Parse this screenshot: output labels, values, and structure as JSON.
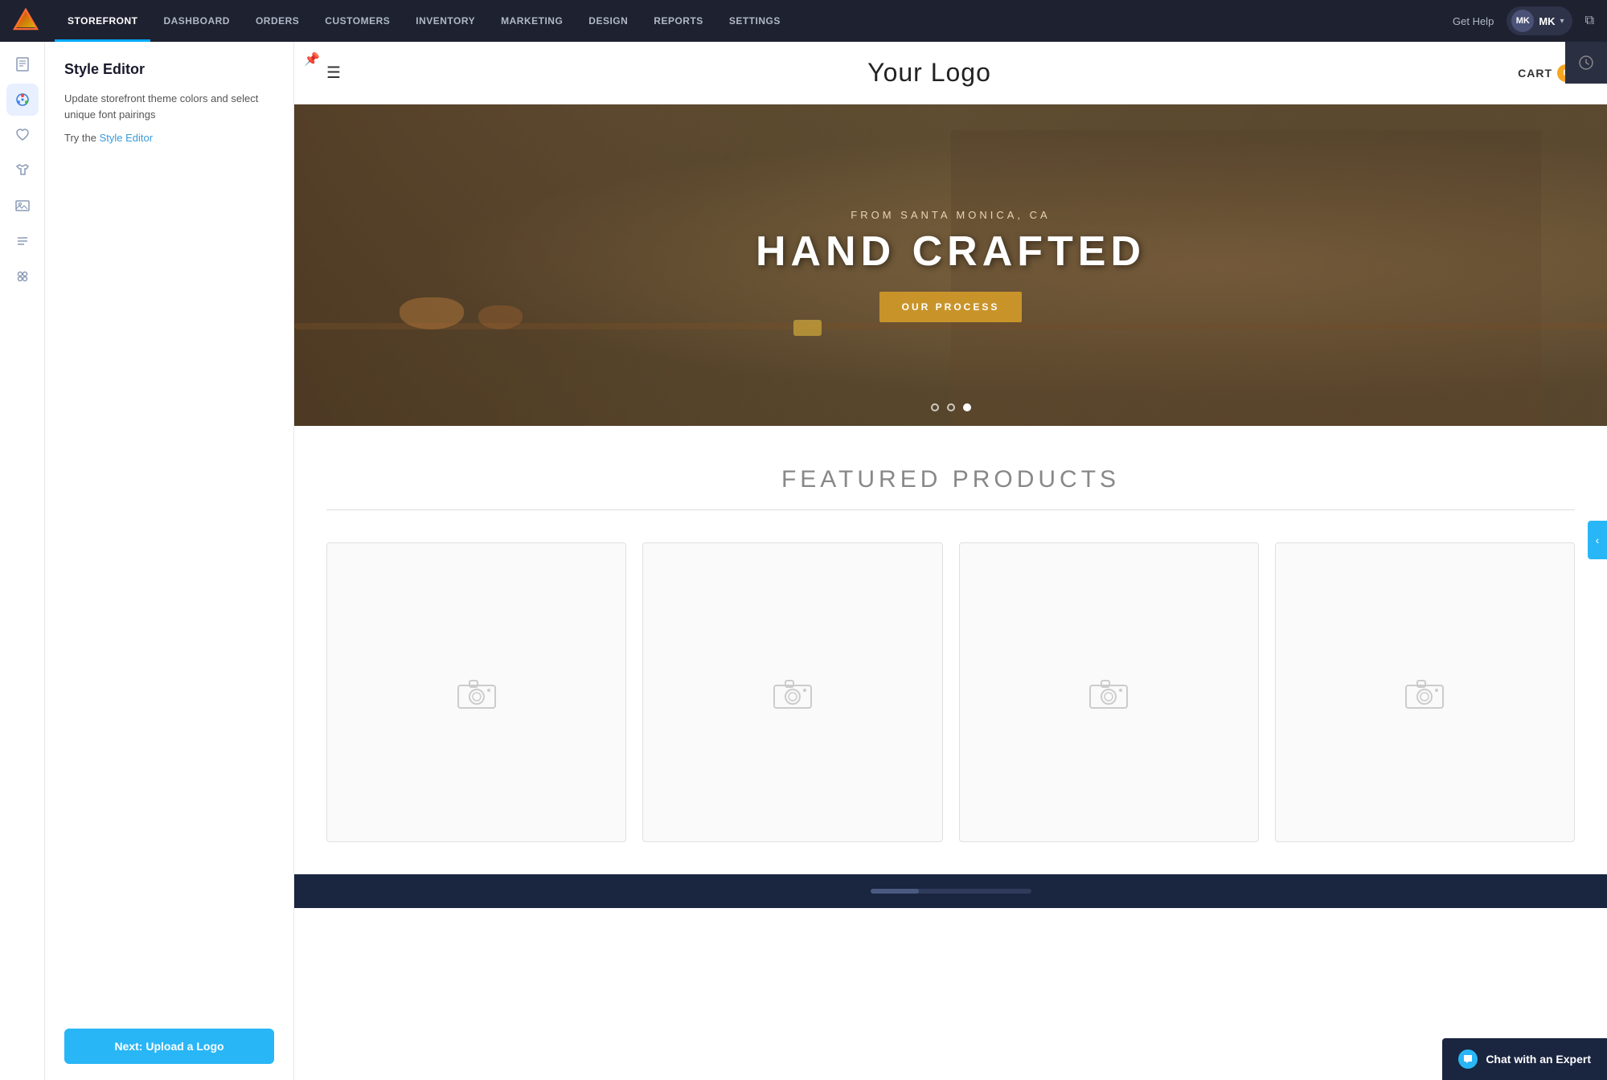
{
  "topNav": {
    "items": [
      {
        "label": "STOREFRONT",
        "active": true
      },
      {
        "label": "DASHBOARD",
        "active": false
      },
      {
        "label": "ORDERS",
        "active": false
      },
      {
        "label": "CUSTOMERS",
        "active": false
      },
      {
        "label": "INVENTORY",
        "active": false
      },
      {
        "label": "MARKETING",
        "active": false
      },
      {
        "label": "DESIGN",
        "active": false
      },
      {
        "label": "REPORTS",
        "active": false
      },
      {
        "label": "SETTINGS",
        "active": false
      }
    ],
    "getHelp": "Get Help",
    "userInitials": "MK",
    "externalLinkIcon": "⧉"
  },
  "iconSidebar": {
    "items": [
      {
        "name": "pages-icon",
        "icon": "⊟",
        "active": false
      },
      {
        "name": "style-icon",
        "icon": "🎨",
        "active": true
      },
      {
        "name": "heart-icon",
        "icon": "♡",
        "active": false
      },
      {
        "name": "shirt-icon",
        "icon": "👕",
        "active": false
      },
      {
        "name": "image-icon",
        "icon": "🖼",
        "active": false
      },
      {
        "name": "menu-icon",
        "icon": "☰",
        "active": false
      },
      {
        "name": "apps-icon",
        "icon": "✦",
        "active": false
      }
    ]
  },
  "stylePanel": {
    "title": "Style Editor",
    "description": "Update storefront theme colors and select unique font pairings",
    "tryText": "Try the",
    "linkLabel": "Style Editor",
    "nextButton": "Next: Upload a Logo"
  },
  "storefront": {
    "logoText": "Your Logo",
    "cartLabel": "CART",
    "cartCount": "0",
    "hero": {
      "subtitle": "FROM SANTA MONICA, CA",
      "title": "HAND CRAFTED",
      "buttonLabel": "OUR PROCESS",
      "dots": [
        {
          "type": "empty"
        },
        {
          "type": "empty"
        },
        {
          "type": "filled"
        }
      ]
    },
    "featured": {
      "title": "FEATURED PRODUCTS",
      "products": [
        {
          "id": 1
        },
        {
          "id": 2
        },
        {
          "id": 3
        },
        {
          "id": 4
        }
      ]
    }
  },
  "chat": {
    "label": "Chat with an Expert",
    "bubbleIcon": "💬"
  },
  "colors": {
    "navBg": "#1e2130",
    "accent": "#29b6f6",
    "cartBadge": "#f5a623",
    "heroBtnBg": "#c8942a",
    "chatBg": "#1a2540"
  }
}
